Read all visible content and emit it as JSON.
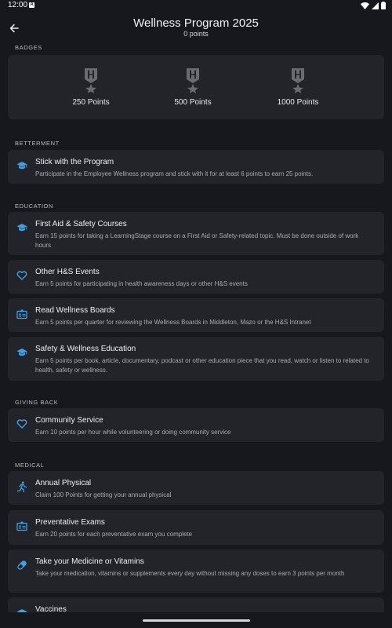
{
  "status_bar": {
    "time": "12:00",
    "notification_glyph": "A"
  },
  "header": {
    "title": "Wellness Program 2025",
    "points": "0 points"
  },
  "badges": {
    "label": "BADGES",
    "items": [
      {
        "label": "250 Points",
        "icon": "medal-icon"
      },
      {
        "label": "500 Points",
        "icon": "medal-icon"
      },
      {
        "label": "1000 Points",
        "icon": "medal-icon"
      }
    ]
  },
  "sections": {
    "betterment": {
      "label": "BETTERMENT",
      "items": [
        {
          "title": "Stick with the Program",
          "desc": "Participate in the Employee Wellness program and stick with it for at least 6 points to earn 25 points.",
          "icon": "graduation-cap-icon"
        }
      ]
    },
    "education": {
      "label": "EDUCATION",
      "items": [
        {
          "title": "First Aid & Safety Courses",
          "desc": "Earn 15 points for taking a LearningStage course on a First Aid or Safety-related topic. Must be done outside of work hours",
          "icon": "graduation-cap-icon"
        },
        {
          "title": "Other H&S Events",
          "desc": "Earn 5 points for participating in health awareness days or other H&S events",
          "icon": "heart-icon"
        },
        {
          "title": "Read Wellness Boards",
          "desc": "Earn 5 points per quarter for reviewing the Wellness Boards in Middleton, Mazo or the H&S Intranet",
          "icon": "id-card-icon"
        },
        {
          "title": "Safety & Wellness Education",
          "desc": "Earn 5 points per book, article, documentary, podcast or other education piece that you read, watch or listen to related to health, safety or wellness.",
          "icon": "graduation-cap-icon"
        }
      ]
    },
    "giving_back": {
      "label": "GIVING BACK",
      "items": [
        {
          "title": "Community Service",
          "desc": "Earn 10 points per hour while volunteering or doing community service",
          "icon": "heart-icon"
        }
      ]
    },
    "medical": {
      "label": "MEDICAL",
      "items": [
        {
          "title": "Annual Physical",
          "desc": "Claim 100 Points for getting your annual physical",
          "icon": "running-person-icon"
        },
        {
          "title": "Preventative Exams",
          "desc": "Earn 20 points for each preventative exam you complete",
          "icon": "id-card-icon"
        },
        {
          "title": "Take your Medicine or Vitamins",
          "desc": "Take your medication, vitamins or supplements every day without missing any doses to earn 3 points per month",
          "icon": "pill-icon"
        },
        {
          "title": "Vaccines",
          "desc": "",
          "icon": "graduation-cap-icon"
        }
      ]
    }
  },
  "colors": {
    "background": "#17181d",
    "card": "#232429",
    "accent": "#3ea0e8",
    "badge_icon": "#6b6c72"
  }
}
